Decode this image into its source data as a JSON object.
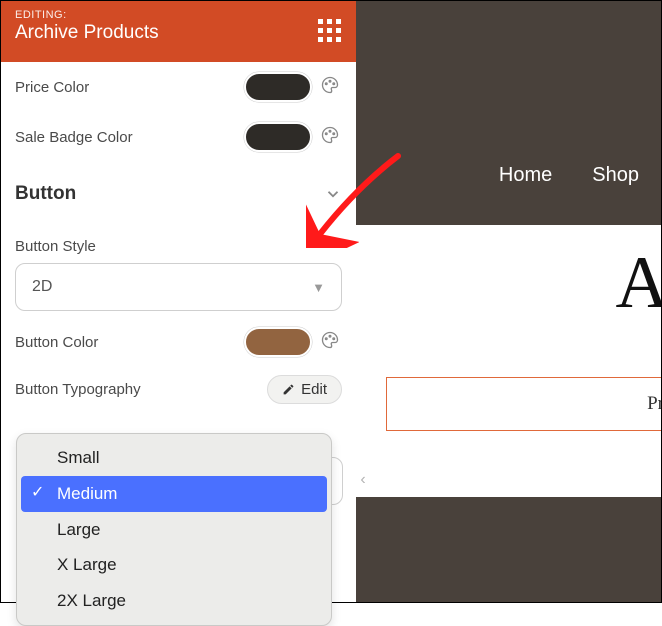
{
  "header": {
    "editing_label": "EDITING:",
    "title": "Archive Products"
  },
  "colors": {
    "swatch_dark": "#2e2b27",
    "swatch_brown": "#926440",
    "accent": "#d24b25"
  },
  "settings": {
    "price_color_label": "Price Color",
    "sale_badge_color_label": "Sale Badge Color"
  },
  "button_section": {
    "title": "Button",
    "style_label": "Button Style",
    "style_value": "2D",
    "color_label": "Button Color",
    "typography_label": "Button Typography",
    "edit_label": "Edit"
  },
  "size_options": [
    "Small",
    "Medium",
    "Large",
    "X Large",
    "2X Large"
  ],
  "size_selected_index": 1,
  "preview": {
    "nav": {
      "home": "Home",
      "shop": "Shop"
    },
    "heading_fragment": "A",
    "box_text_fragment": "Pr"
  }
}
